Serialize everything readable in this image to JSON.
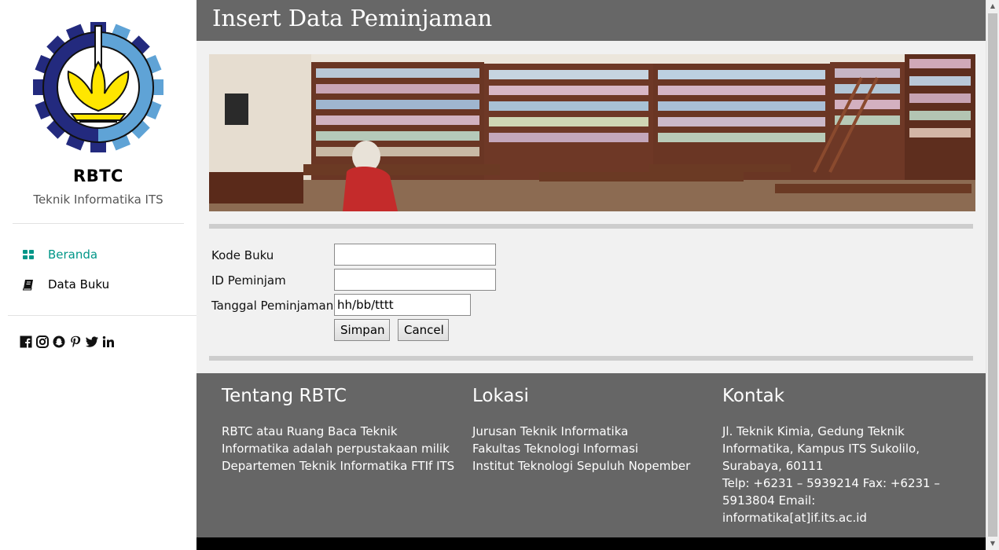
{
  "sidebar": {
    "brand": "RBTC",
    "subtitle": "Teknik Informatika ITS",
    "nav": [
      {
        "label": "Beranda",
        "icon": "dashboard-icon",
        "active": true
      },
      {
        "label": "Data Buku",
        "icon": "book-icon",
        "active": false
      }
    ],
    "social_icons": [
      "facebook-icon",
      "instagram-icon",
      "snapchat-icon",
      "pinterest-icon",
      "twitter-icon",
      "linkedin-icon"
    ],
    "accent_color": "#009688"
  },
  "header": {
    "title": "Insert Data Peminjaman"
  },
  "form": {
    "kode_buku_label": "Kode Buku",
    "kode_buku_value": "",
    "id_peminjam_label": "ID Peminjam",
    "id_peminjam_value": "",
    "tanggal_label": "Tanggal Peminjaman",
    "tanggal_value": "hh/bb/tttt",
    "save_label": "Simpan",
    "cancel_label": "Cancel"
  },
  "footer": {
    "about_title": "Tentang RBTC",
    "about_text": "RBTC atau Ruang Baca Teknik\nInformatika adalah perpustakaan milik\nDepartemen Teknik Informatika FTIf ITS",
    "location_title": "Lokasi",
    "location_text": "Jurusan Teknik Informatika\nFakultas Teknologi Informasi\nInstitut Teknologi Sepuluh Nopember",
    "contact_title": "Kontak",
    "contact_text": "Jl. Teknik Kimia, Gedung Teknik\nInformatika, Kampus ITS Sukolilo,\nSurabaya, 60111\nTelp: +6231 – 5939214 Fax: +6231 –\n5913804 Email:\ninformatika[at]if.its.ac.id"
  },
  "colors": {
    "header_bg": "#676767",
    "footer_bg": "#666666"
  }
}
